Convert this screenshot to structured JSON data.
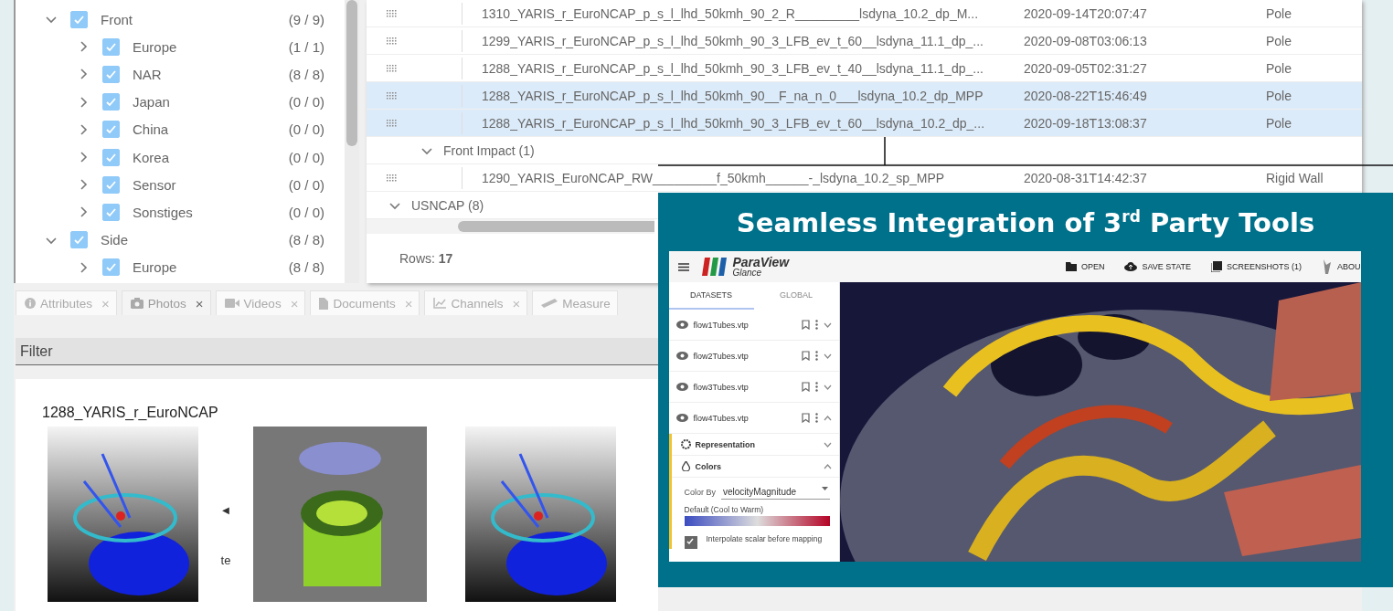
{
  "tree": {
    "items": [
      {
        "label": "Front",
        "count": "(9 / 9)",
        "checked": true,
        "expanded": true,
        "children": [
          {
            "label": "Europe",
            "count": "(1 / 1)",
            "checked": true,
            "expanded": false
          },
          {
            "label": "NAR",
            "count": "(8 / 8)",
            "checked": true,
            "expanded": false
          },
          {
            "label": "Japan",
            "count": "(0 / 0)",
            "checked": true,
            "expanded": false
          },
          {
            "label": "China",
            "count": "(0 / 0)",
            "checked": true,
            "expanded": false
          },
          {
            "label": "Korea",
            "count": "(0 / 0)",
            "checked": true,
            "expanded": false
          },
          {
            "label": "Sensor",
            "count": "(0 / 0)",
            "checked": true,
            "expanded": false
          },
          {
            "label": "Sonstiges",
            "count": "(0 / 0)",
            "checked": true,
            "expanded": false
          }
        ]
      },
      {
        "label": "Side",
        "count": "(8 / 8)",
        "checked": true,
        "expanded": true,
        "children": [
          {
            "label": "Europe",
            "count": "(8 / 8)",
            "checked": true,
            "expanded": false
          }
        ]
      }
    ]
  },
  "table": {
    "rows": [
      {
        "kind": "continued",
        "children": [
          {
            "kind": "data",
            "name": "1310_YARIS_r_EuroNCAP_p_s_l_lhd_50kmh_90_2_R_________lsdyna_10.2_dp_M...",
            "date": "2020-09-14T20:07:47",
            "type": "Pole",
            "selected": false
          },
          {
            "kind": "data",
            "name": "1299_YARIS_r_EuroNCAP_p_s_l_lhd_50kmh_90_3_LFB_ev_t_60__lsdyna_11.1_dp_...",
            "date": "2020-09-08T03:06:13",
            "type": "Pole",
            "selected": false
          },
          {
            "kind": "data",
            "name": "1288_YARIS_r_EuroNCAP_p_s_l_lhd_50kmh_90_3_LFB_ev_t_40__lsdyna_11.1_dp_...",
            "date": "2020-09-05T02:31:27",
            "type": "Pole",
            "selected": false
          },
          {
            "kind": "data",
            "name": "1288_YARIS_r_EuroNCAP_p_s_l_lhd_50kmh_90__F_na_n_0___lsdyna_10.2_dp_MPP",
            "date": "2020-08-22T15:46:49",
            "type": "Pole",
            "selected": true
          },
          {
            "kind": "data",
            "name": "1288_YARIS_r_EuroNCAP_p_s_l_lhd_50kmh_90_3_LFB_ev_t_60__lsdyna_10.2_dp_...",
            "date": "2020-09-18T13:08:37",
            "type": "Pole",
            "selected": true
          },
          {
            "kind": "group",
            "label": "Front Impact (1)",
            "expanded": true,
            "children": [
              {
                "kind": "data",
                "name": "1290_YARIS_EuroNCAP_RW_________f_50kmh______-_lsdyna_10.2_sp_MPP",
                "date": "2020-08-31T14:42:37",
                "type": "Rigid Wall",
                "selected": false
              }
            ]
          }
        ]
      },
      {
        "kind": "group",
        "label": "USNCAP (8)",
        "expanded": true
      }
    ],
    "footer_label": "Rows:",
    "footer_value": "17"
  },
  "bottom_tabs": [
    {
      "label": "Attributes",
      "selected": false,
      "close": "×"
    },
    {
      "label": "Photos",
      "selected": true,
      "close": "×"
    },
    {
      "label": "Videos",
      "selected": false,
      "close": "×"
    },
    {
      "label": "Documents",
      "selected": false,
      "close": "×"
    },
    {
      "label": "Channels",
      "selected": false,
      "close": "×"
    },
    {
      "label": "Measure",
      "selected": false
    }
  ],
  "filter": {
    "placeholder": "Filter"
  },
  "photos": {
    "title": "1288_YARIS_r_EuroNCAP",
    "arrow": "◄",
    "caption": "te"
  },
  "overlay": {
    "title": "Seamless Integration of 3$^{rd}$ Party Tools",
    "paraview": {
      "logo_name": "ParaView",
      "logo_sub": "Glance",
      "actions": [
        "OPEN",
        "SAVE STATE",
        "SCREENSHOTS (1)",
        "ABOU"
      ],
      "tabs": [
        {
          "label": "DATASETS",
          "selected": true
        },
        {
          "label": "GLOBAL",
          "selected": false
        }
      ],
      "datasets": [
        {
          "name": "flow1Tubes.vtp",
          "expanded": false
        },
        {
          "name": "flow2Tubes.vtp",
          "expanded": false
        },
        {
          "name": "flow3Tubes.vtp",
          "expanded": false
        },
        {
          "name": "flow4Tubes.vtp",
          "expanded": true
        }
      ],
      "sections": [
        {
          "label": "Representation",
          "expanded": false
        },
        {
          "label": "Colors",
          "expanded": true
        }
      ],
      "color_by": {
        "label": "Color By",
        "value": "velocityMagnitude"
      },
      "preset": "Default (Cool to Warm)",
      "interpolate": {
        "label": "Interpolate scalar before mapping",
        "checked": true
      }
    }
  }
}
